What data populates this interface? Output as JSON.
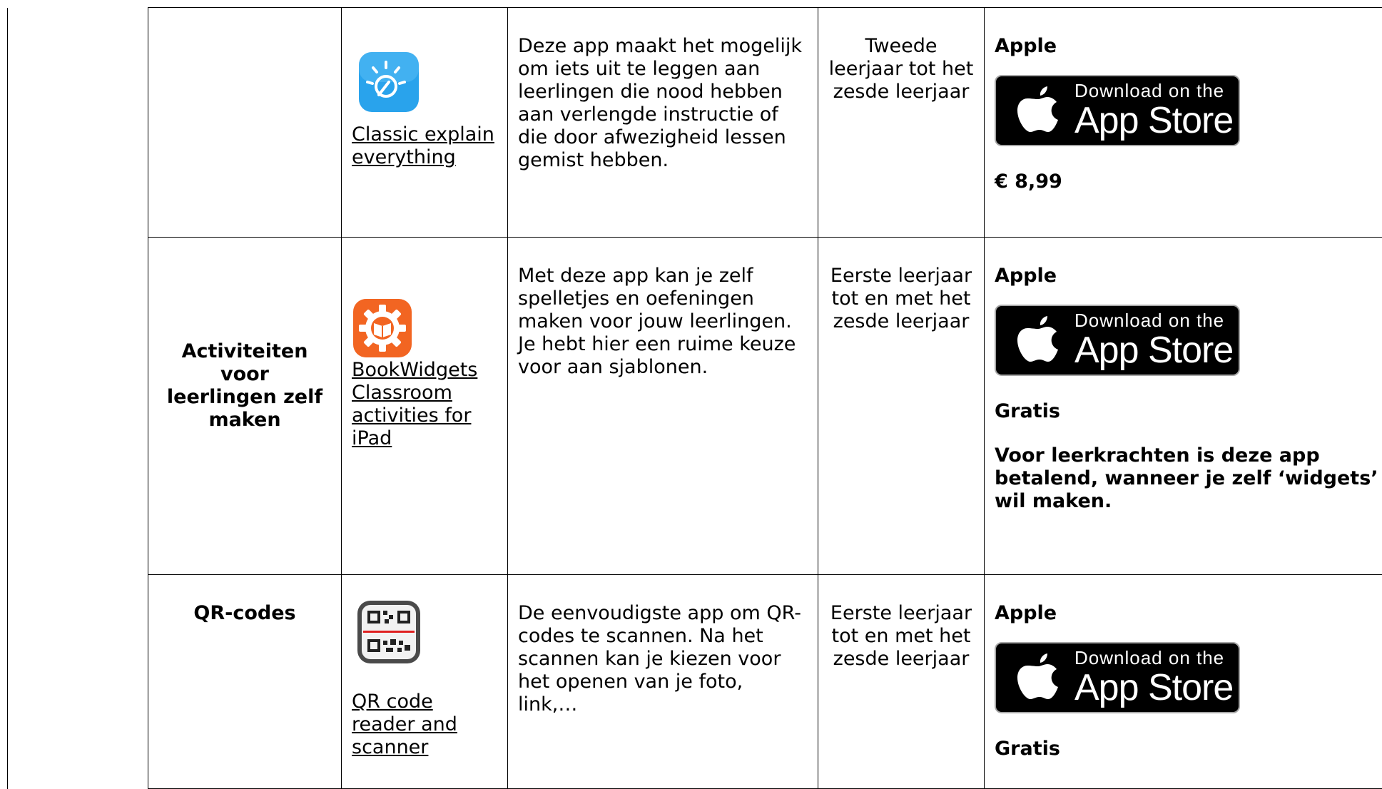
{
  "rows": [
    {
      "category": "",
      "app_name": "Classic explain everything",
      "icon": "explain-everything-icon",
      "description": "Deze app maakt het mogelijk om iets uit te leggen aan leerlingen die nood hebben aan verlengde instructie of die door afwezigheid lessen gemist hebben.",
      "grade": "Tweede leerjaar tot het zesde leerjaar",
      "platform": "Apple",
      "badge_small": "Download on the",
      "badge_big": "App Store",
      "price": "€ 8,99",
      "note": ""
    },
    {
      "category": "Activiteiten voor leerlingen zelf maken",
      "app_name": "BookWidgets Classroom activities for iPad",
      "icon": "bookwidgets-icon",
      "description": "Met deze app kan je zelf spelletjes en oefeningen maken voor jouw leerlingen. Je hebt hier een ruime keuze voor aan sjablonen.",
      "grade": "Eerste leerjaar tot en met het zesde leerjaar",
      "platform": "Apple",
      "badge_small": "Download on the",
      "badge_big": "App Store",
      "price": "Gratis",
      "note": "Voor leerkrachten is deze app betalend, wanneer je zelf ‘widgets’ wil maken."
    },
    {
      "category": "QR-codes",
      "app_name": "QR code reader and scanner",
      "icon": "qr-scanner-icon",
      "description": "De eenvoudigste app om QR-codes te scannen. Na het scannen kan je kiezen voor het openen van je foto, link,…",
      "grade": "Eerste leerjaar tot en met het zesde leerjaar",
      "platform": "Apple",
      "badge_small": "Download on the",
      "badge_big": "App Store",
      "price": "Gratis",
      "note": ""
    }
  ],
  "colors": {
    "explain_icon": "#29a3ec",
    "bookwidgets_icon": "#f26522",
    "badge_bg": "#000000"
  }
}
